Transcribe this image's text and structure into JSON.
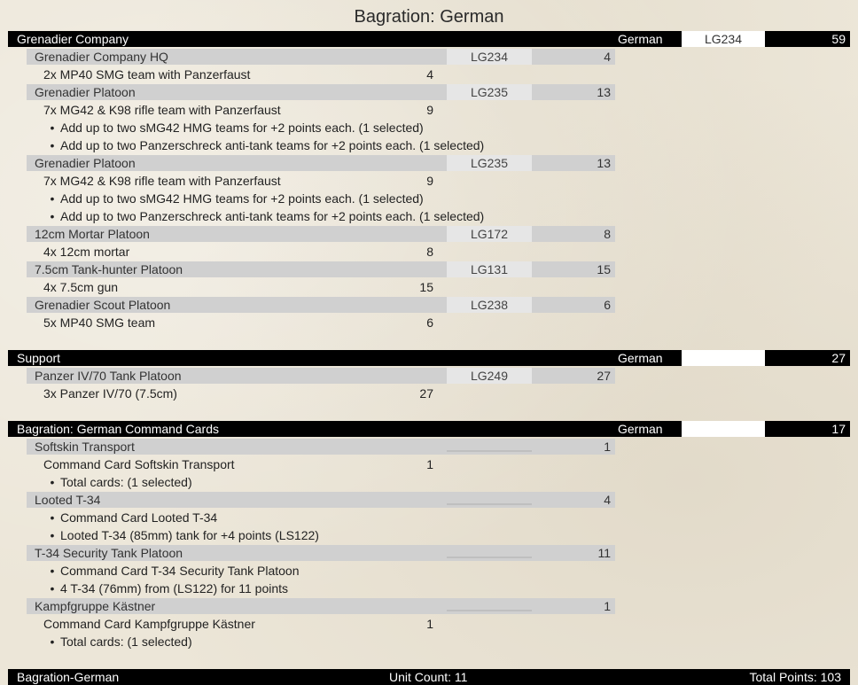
{
  "title": "Bagration: German",
  "sections": [
    {
      "name": "Grenadier Company",
      "nation": "German",
      "code": "LG234",
      "points": "59",
      "units": [
        {
          "name": "Grenadier Company HQ",
          "code": "LG234",
          "points": "4",
          "lines": [
            {
              "text": "2x MP40 SMG team with Panzerfaust",
              "points": "4"
            }
          ],
          "bullets": []
        },
        {
          "name": "Grenadier Platoon",
          "code": "LG235",
          "points": "13",
          "lines": [
            {
              "text": "7x MG42 & K98 rifle team with Panzerfaust",
              "points": "9"
            }
          ],
          "bullets": [
            "Add up to two sMG42 HMG teams for +2 points each.  (1 selected)",
            "Add up to two Panzerschreck anti-tank teams for +2 points each.  (1 selected)"
          ]
        },
        {
          "name": "Grenadier Platoon",
          "code": "LG235",
          "points": "13",
          "lines": [
            {
              "text": "7x MG42 & K98 rifle team with Panzerfaust",
              "points": "9"
            }
          ],
          "bullets": [
            "Add up to two sMG42 HMG teams for +2 points each.  (1 selected)",
            "Add up to two Panzerschreck anti-tank teams for +2 points each.  (1 selected)"
          ]
        },
        {
          "name": "12cm Mortar Platoon",
          "code": "LG172",
          "points": "8",
          "lines": [
            {
              "text": "4x 12cm mortar",
              "points": "8"
            }
          ],
          "bullets": []
        },
        {
          "name": "7.5cm Tank-hunter Platoon",
          "code": "LG131",
          "points": "15",
          "lines": [
            {
              "text": "4x 7.5cm gun",
              "points": "15"
            }
          ],
          "bullets": []
        },
        {
          "name": "Grenadier Scout Platoon",
          "code": "LG238",
          "points": "6",
          "lines": [
            {
              "text": "5x MP40 SMG team",
              "points": "6"
            }
          ],
          "bullets": []
        }
      ]
    },
    {
      "name": "Support",
      "nation": "German",
      "code": "",
      "points": "27",
      "units": [
        {
          "name": "Panzer IV/70 Tank Platoon",
          "code": "LG249",
          "points": "27",
          "lines": [
            {
              "text": "3x Panzer IV/70 (7.5cm)",
              "points": "27"
            }
          ],
          "bullets": []
        }
      ]
    },
    {
      "name": "Bagration: German Command Cards",
      "nation": "German",
      "code": "",
      "points": "17",
      "units": [
        {
          "name": "Softskin Transport",
          "code": "",
          "points": "1",
          "lines": [
            {
              "text": "Command Card Softskin Transport",
              "points": "1"
            }
          ],
          "bullets": [
            "Total cards:  (1 selected)"
          ]
        },
        {
          "name": "Looted T-34",
          "code": "",
          "points": "4",
          "lines": [],
          "bullets": [
            "Command Card Looted T-34",
            "Looted T-34 (85mm) tank for +4 points (LS122)"
          ]
        },
        {
          "name": "T-34 Security Tank Platoon",
          "code": "",
          "points": "11",
          "lines": [],
          "bullets": [
            "Command Card T-34 Security Tank Platoon",
            "4 T-34 (76mm) from (LS122) for 11 points"
          ]
        },
        {
          "name": "Kampfgruppe Kästner",
          "code": "",
          "points": "1",
          "lines": [
            {
              "text": "Command Card Kampfgruppe Kästner",
              "points": "1"
            }
          ],
          "bullets": [
            "Total cards:  (1 selected)"
          ]
        }
      ]
    }
  ],
  "footer": {
    "name": "Bagration-German",
    "unit_count": "Unit Count: 11",
    "total_points": "Total Points: 103"
  }
}
